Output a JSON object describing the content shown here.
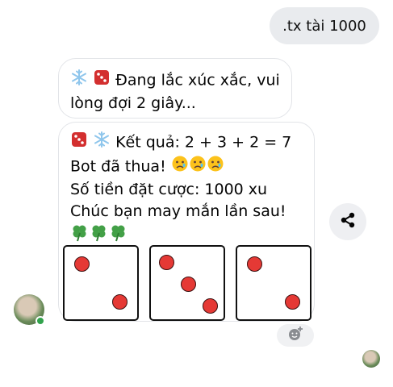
{
  "outgoing": {
    "text": ".tx tài 1000"
  },
  "bubble1": {
    "icons": [
      "snowflake-emoji",
      "dice-emoji"
    ],
    "line1": "Đang lắc xúc xắc, vui",
    "line2": "lòng đợi 2 giây..."
  },
  "bubble2": {
    "icons": [
      "dice-emoji",
      "snowflake-emoji"
    ],
    "result": "Kết quả: 2 + 3 + 2 = 7",
    "lose": "Bot đã thua!",
    "bet": "Số tiền đặt cược: 1000 xu",
    "luck": "Chúc bạn may mắn lần sau!",
    "lose_emoji": "sad-face-emoji x3",
    "clover_emoji": "four-leaf-clover-emoji x3",
    "dice_values": [
      2,
      3,
      2
    ]
  },
  "colors": {
    "pip": "#e53935",
    "outgoing_bg": "#e9ebee",
    "online": "#31a24c"
  },
  "icons": {
    "share": "share-icon",
    "react": "add-reaction-icon"
  }
}
